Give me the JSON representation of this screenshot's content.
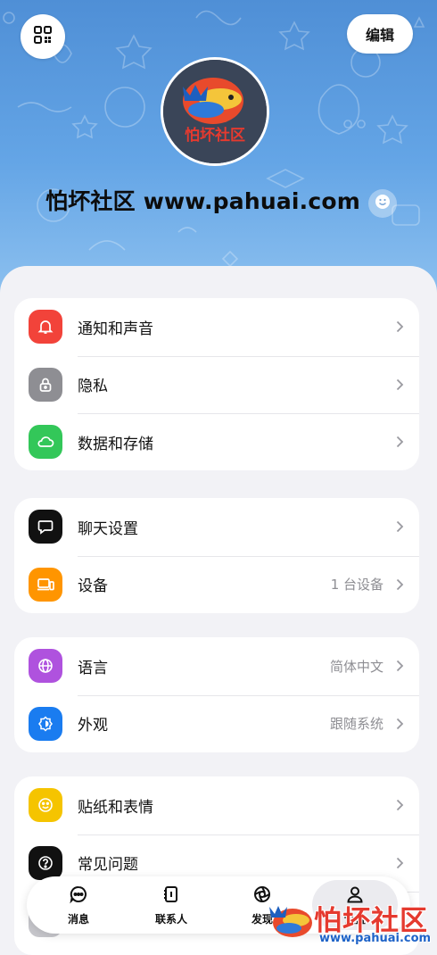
{
  "header": {
    "qr_icon": "qr-code-icon",
    "edit_label": "编辑",
    "avatar_text": "怕坏社区",
    "profile_name": "怕坏社区 www.pahuai.com",
    "emoji_icon": "smiley-icon"
  },
  "groups": [
    {
      "items": [
        {
          "label": "通知和声音",
          "icon": "bell-icon",
          "color": "#f2433a"
        },
        {
          "label": "隐私",
          "icon": "lock-icon",
          "color": "#8e8e93"
        },
        {
          "label": "数据和存储",
          "icon": "cloud-icon",
          "color": "#33c759"
        }
      ]
    },
    {
      "items": [
        {
          "label": "聊天设置",
          "icon": "chat-bubble-icon",
          "color": "#111111"
        },
        {
          "label": "设备",
          "icon": "devices-icon",
          "color": "#ff9500",
          "value": "1 台设备"
        }
      ]
    },
    {
      "items": [
        {
          "label": "语言",
          "icon": "globe-icon",
          "color": "#af52de",
          "value": "简体中文"
        },
        {
          "label": "外观",
          "icon": "appearance-icon",
          "color": "#1a7cf0",
          "value": "跟随系统"
        }
      ]
    },
    {
      "items": [
        {
          "label": "贴纸和表情",
          "icon": "sticker-smiley-icon",
          "color": "#f5c400"
        },
        {
          "label": "常见问题",
          "icon": "question-icon",
          "color": "#111111"
        }
      ]
    }
  ],
  "tabbar": {
    "tabs": [
      {
        "label": "消息",
        "icon": "message-icon"
      },
      {
        "label": "联系人",
        "icon": "contacts-icon"
      },
      {
        "label": "发现",
        "icon": "discover-icon"
      },
      {
        "label": "设置",
        "icon": "person-icon",
        "active": true
      }
    ]
  },
  "watermark": {
    "text": "怕坏社区",
    "url": "www.pahuai.com"
  }
}
